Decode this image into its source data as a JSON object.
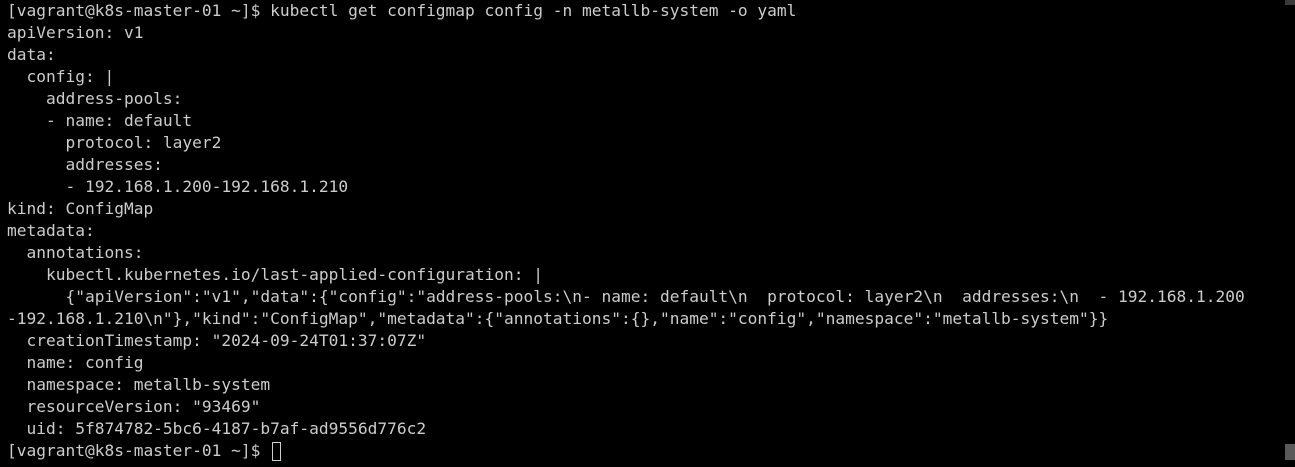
{
  "terminal": {
    "lines": [
      "[vagrant@k8s-master-01 ~]$ kubectl get configmap config -n metallb-system -o yaml",
      "apiVersion: v1",
      "data:",
      "  config: |",
      "    address-pools:",
      "    - name: default",
      "      protocol: layer2",
      "      addresses:",
      "      - 192.168.1.200-192.168.1.210",
      "kind: ConfigMap",
      "metadata:",
      "  annotations:",
      "    kubectl.kubernetes.io/last-applied-configuration: |",
      "      {\"apiVersion\":\"v1\",\"data\":{\"config\":\"address-pools:\\n- name: default\\n  protocol: layer2\\n  addresses:\\n  - 192.168.1.200",
      "-192.168.1.210\\n\"},\"kind\":\"ConfigMap\",\"metadata\":{\"annotations\":{},\"name\":\"config\",\"namespace\":\"metallb-system\"}}",
      "  creationTimestamp: \"2024-09-24T01:37:07Z\"",
      "  name: config",
      "  namespace: metallb-system",
      "  resourceVersion: \"93469\"",
      "  uid: 5f874782-5bc6-4187-b7af-ad9556d776c2"
    ],
    "prompt": "[vagrant@k8s-master-01 ~]$ ",
    "colors": {
      "background": "#000000",
      "foreground": "#cccccc"
    }
  }
}
